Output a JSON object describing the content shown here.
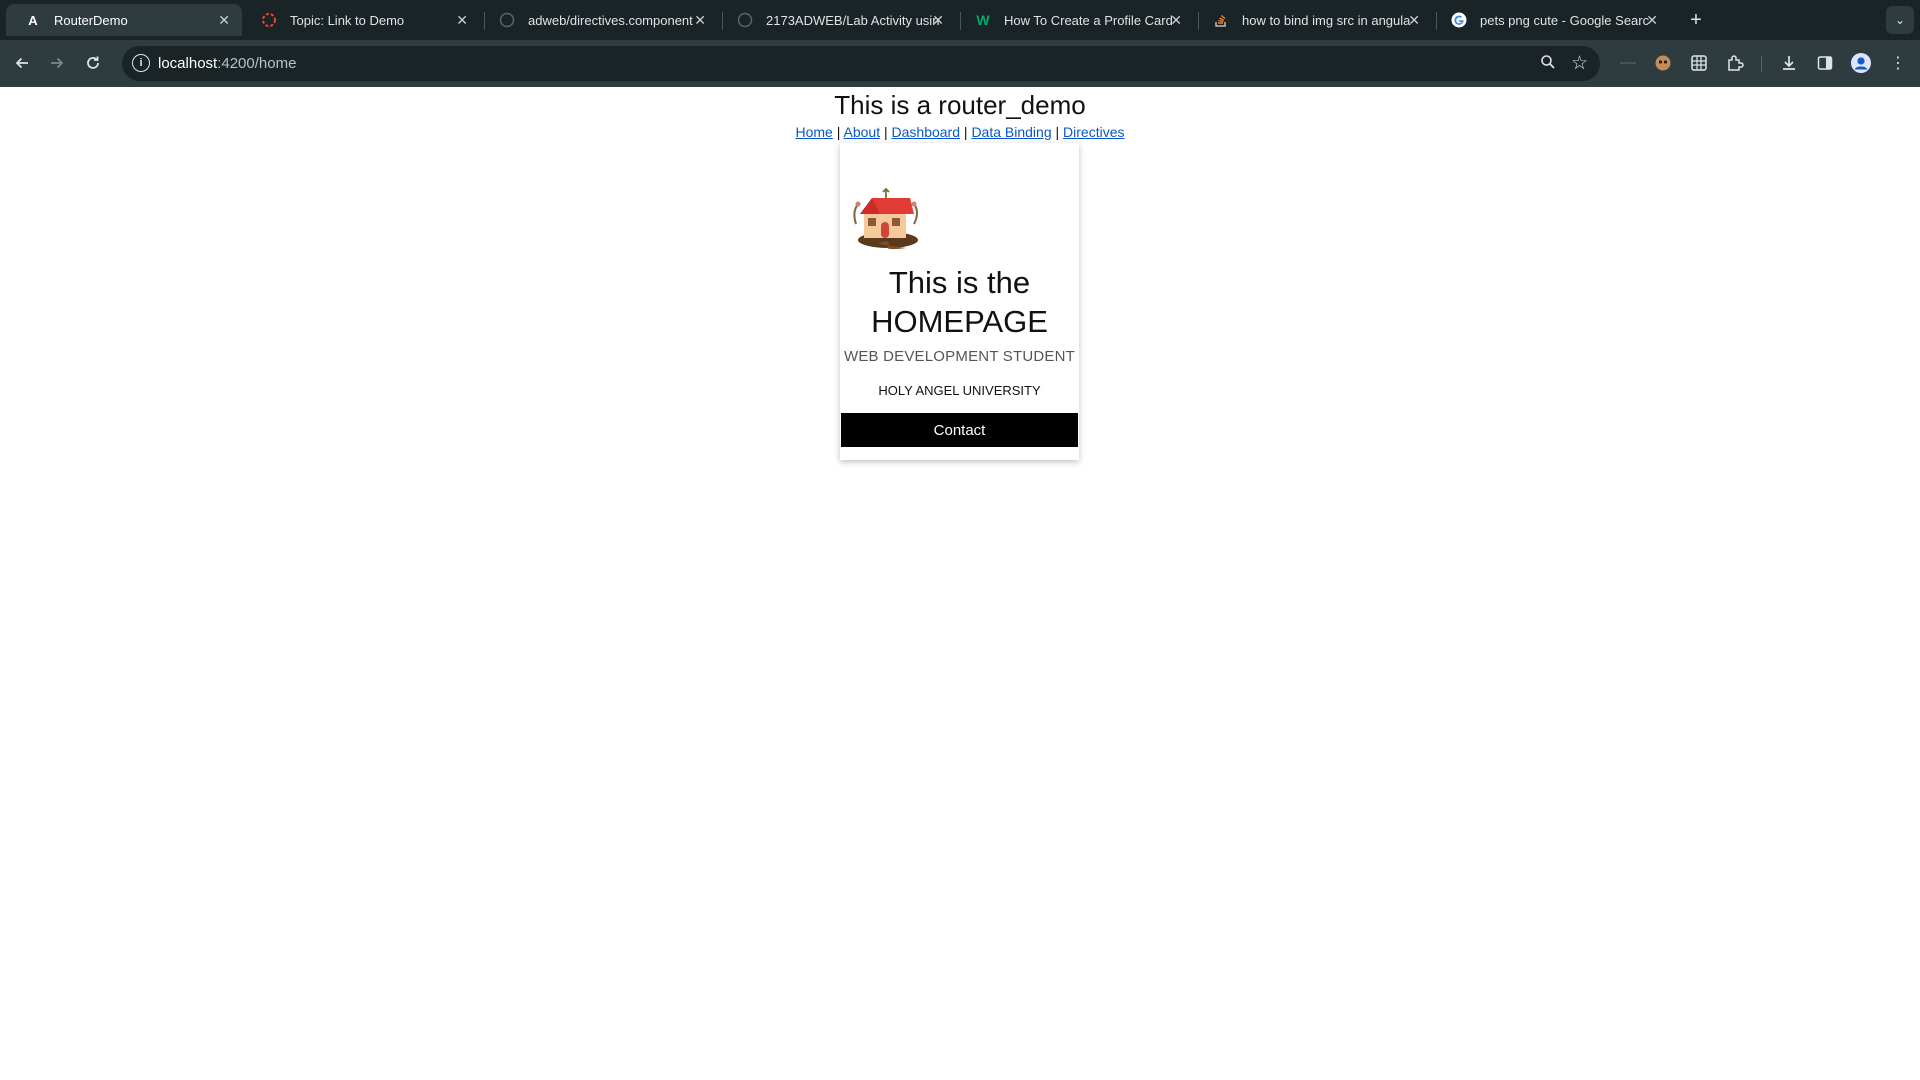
{
  "browser": {
    "tabs": [
      {
        "title": "RouterDemo",
        "favicon": "angular-icon",
        "active": true
      },
      {
        "title": "Topic: Link to Demo",
        "favicon": "loading-icon"
      },
      {
        "title": "adweb/directives.component",
        "favicon": "github-icon"
      },
      {
        "title": "2173ADWEB/Lab Activity usin",
        "favicon": "github-icon"
      },
      {
        "title": "How To Create a Profile Card",
        "favicon": "w3schools-icon"
      },
      {
        "title": "how to bind img src in angula",
        "favicon": "stackoverflow-icon"
      },
      {
        "title": "pets png cute - Google Searc",
        "favicon": "google-icon"
      }
    ],
    "new_tab": "+",
    "url_host": "localhost",
    "url_path": ":4200/home"
  },
  "page": {
    "title": "This is a router_demo",
    "nav": {
      "links": [
        "Home",
        "About",
        "Dashboard",
        "Data Binding",
        "Directives"
      ],
      "separator": "|"
    },
    "card": {
      "image": "house-icon",
      "heading_line1": "This is the",
      "heading_line2": "HOMEPAGE",
      "subtitle": "WEB DEVELOPMENT STUDENT",
      "university": "HOLY ANGEL UNIVERSITY",
      "button_label": "Contact"
    }
  },
  "colors": {
    "chrome_bg": "#1f2a2e",
    "link": "#0a58ca",
    "button_bg": "#000000"
  }
}
